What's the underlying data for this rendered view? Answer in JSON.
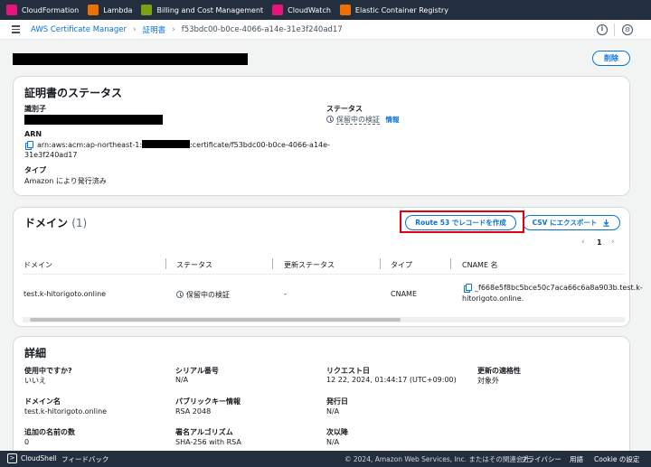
{
  "topbar": {
    "favorites": [
      {
        "label": "CloudFormation",
        "icon": "cloudformation-icon",
        "color": "#e7157b"
      },
      {
        "label": "Lambda",
        "icon": "lambda-icon",
        "color": "#ed7100"
      },
      {
        "label": "Billing and Cost Management",
        "icon": "billing-icon",
        "color": "#7aa116"
      },
      {
        "label": "CloudWatch",
        "icon": "cloudwatch-icon",
        "color": "#e7157b"
      },
      {
        "label": "Elastic Container Registry",
        "icon": "ecr-icon",
        "color": "#ed7100"
      }
    ]
  },
  "breadcrumb": {
    "service": "AWS Certificate Manager",
    "section": "証明書",
    "current": "f53bdc00-b0ce-4066-a14e-31e3f240ad17",
    "separator": "›"
  },
  "header_icons": {
    "info": "i",
    "settings": "⚙"
  },
  "page": {
    "delete_label": "削除"
  },
  "status_card": {
    "title": "証明書のステータス",
    "identifier_label": "識別子",
    "arn_label": "ARN",
    "arn_prefix": "arn:aws:acm:ap-northeast-1:",
    "arn_suffix": ":certificate/f53bdc00-b0ce-4066-a14e-",
    "arn_line2": "31e3f240ad17",
    "type_label": "タイプ",
    "type_value": "Amazon により発行済み",
    "status_label": "ステータス",
    "status_value": "保留中の検証",
    "status_info_link": "情報"
  },
  "domain_card": {
    "title": "ドメイン",
    "count": "(1)",
    "route53_button": "Route 53 でレコードを作成",
    "csv_button": "CSV にエクスポート",
    "pagination": {
      "prev": "‹",
      "page": "1",
      "next": "›"
    },
    "columns": [
      "ドメイン",
      "ステータス",
      "更新ステータス",
      "タイプ",
      "CNAME 名"
    ],
    "rows": [
      {
        "domain": "test.k-hitorigoto.online",
        "status": "保留中の検証",
        "renewal_status": "-",
        "type": "CNAME",
        "cname_line1": "_f668e5f8bc5bce50c7aca66c6a8a903b.test.k-",
        "cname_line2": "hitorigoto.online."
      }
    ]
  },
  "details_card": {
    "title": "詳細",
    "fields": {
      "in_use_label": "使用中ですか?",
      "in_use_value": "いいえ",
      "serial_label": "シリアル番号",
      "serial_value": "N/A",
      "requested_label": "リクエスト日",
      "requested_value": "12 22, 2024, 01:44:17 (UTC+09:00)",
      "renewal_label": "更新の適格性",
      "renewal_value": "対象外",
      "domain_label": "ドメイン名",
      "domain_value": "test.k-hitorigoto.online",
      "pubkey_label": "パブリックキー情報",
      "pubkey_value": "RSA 2048",
      "issued_label": "発行日",
      "issued_value": "N/A",
      "extra_names_label": "追加の名前の数",
      "extra_names_value": "0",
      "sig_label": "署名アルゴリズム",
      "sig_value": "SHA-256 with RSA",
      "notafter_label": "次以降",
      "notafter_value": "N/A"
    }
  },
  "footer": {
    "cloudshell": "CloudShell",
    "feedback": "フィードバック",
    "copyright": "© 2024, Amazon Web Services, Inc. またはその関連会社。",
    "privacy": "プライバシー",
    "terms": "用語",
    "cookies": "Cookie の設定"
  }
}
